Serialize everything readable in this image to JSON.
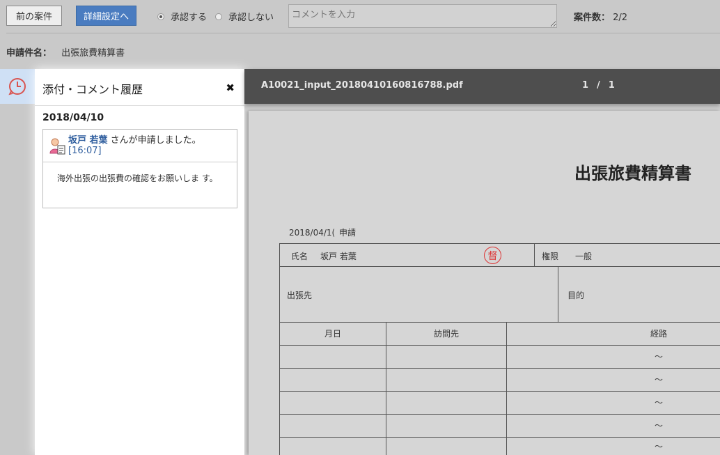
{
  "toolbar": {
    "prev_label": "前の案件",
    "detail_label": "詳細設定へ",
    "approve_label": "承認する",
    "reject_label": "承認しない",
    "comment_placeholder": "コメントを入力",
    "count_label": "案件数：",
    "count_value": "2/2"
  },
  "application": {
    "label": "申請件名：",
    "value": "出張旅費精算書"
  },
  "panel": {
    "title": "添付・コメント履歴",
    "date": "2018/04/10",
    "entry": {
      "name": "坂戸 若葉",
      "action": "さんが申請しました。",
      "time": "[16:07]",
      "comment": "海外出張の出張費の確認をお願いしま す。"
    }
  },
  "viewer": {
    "filename": "A10021_input_20180410160816788.pdf",
    "page_current": "1",
    "page_sep": "/",
    "page_total": "1"
  },
  "document": {
    "title": "出張旅費精算書",
    "date": "2018/04/1(",
    "date_suffix": "申請",
    "name_label": "氏名",
    "name_value": "坂戸 若葉",
    "seal_text": "督",
    "authority_label": "権限",
    "authority_value": "一般",
    "destination_label": "出張先",
    "purpose_label": "目的",
    "col_date": "月日",
    "col_visit": "訪問先",
    "col_route": "経路",
    "route_mark": "～"
  },
  "colors": {
    "accent": "#4a7cc0",
    "link": "#2f5e9e",
    "viewer_bar": "#4e4e4e",
    "seal": "#dd3333"
  }
}
